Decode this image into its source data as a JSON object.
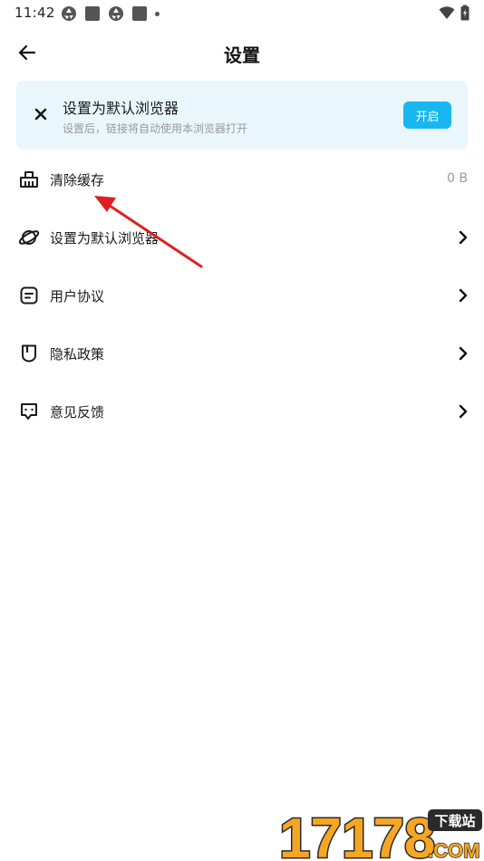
{
  "status_bar": {
    "time": "11:42",
    "left_icons": [
      "aperture-icon",
      "square-notification-icon",
      "aperture-icon",
      "square-notification-icon",
      "dot-icon"
    ],
    "right_icons": [
      "wifi-icon",
      "battery-charging-icon"
    ]
  },
  "header": {
    "title": "设置",
    "back_icon": "arrow-left-icon"
  },
  "banner": {
    "title": "设置为默认浏览器",
    "subtitle": "设置后，链接将自动使用本浏览器打开",
    "button_label": "开启",
    "close_icon": "close-icon",
    "background": "#e9f6fb",
    "accent": "#18b7f0"
  },
  "settings": {
    "items": [
      {
        "label": "清除缓存",
        "value": "0 B",
        "icon": "broom-icon"
      },
      {
        "label": "设置为默认浏览器",
        "icon": "planet-icon",
        "chevron": true
      },
      {
        "label": "用户协议",
        "icon": "document-icon",
        "chevron": true
      },
      {
        "label": "隐私政策",
        "icon": "shield-icon",
        "chevron": true
      },
      {
        "label": "意见反馈",
        "icon": "feedback-icon",
        "chevron": true
      }
    ]
  },
  "annotation": {
    "type": "red-arrow",
    "color": "#e02020",
    "points_to": "清除缓存"
  },
  "watermark": {
    "brand": "17178",
    "badge": "下载站",
    "domain": ".COM",
    "colors": [
      "#f6a623",
      "#2a2a2a"
    ]
  }
}
